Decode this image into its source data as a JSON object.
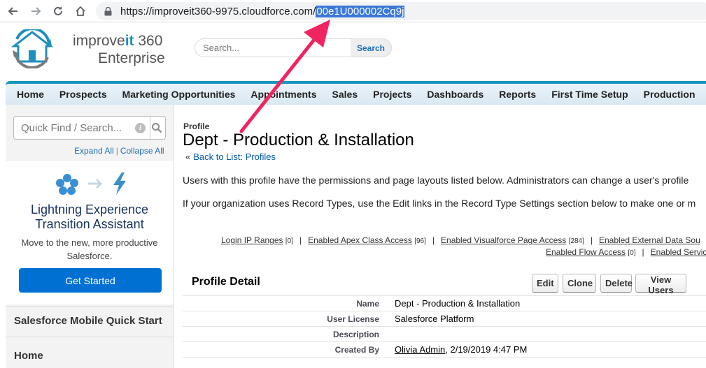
{
  "browser": {
    "url_base": "https://improveit360-9975.cloudforce.com/",
    "url_highlight": "00e1U000002Cq9j"
  },
  "header": {
    "logo_line1_a": "improve",
    "logo_line1_b": "it",
    "logo_line1_c": " 360",
    "logo_line2": "Enterprise",
    "search_placeholder": "Search...",
    "search_button": "Search"
  },
  "tabs": [
    {
      "label": "Home"
    },
    {
      "label": "Prospects"
    },
    {
      "label": "Marketing Opportunities"
    },
    {
      "label": "Appointments"
    },
    {
      "label": "Sales"
    },
    {
      "label": "Projects"
    },
    {
      "label": "Dashboards"
    },
    {
      "label": "Reports"
    },
    {
      "label": "First Time Setup"
    },
    {
      "label": "Production"
    }
  ],
  "sidebar": {
    "quickfind_placeholder": "Quick Find / Search...",
    "info_glyph": "i",
    "expand_all": "Expand All",
    "separator": "|",
    "collapse_all": "Collapse All",
    "lightning_title_1": "Lightning Experience",
    "lightning_title_2": "Transition Assistant",
    "lightning_sub_1": "Move to the new, more productive",
    "lightning_sub_2": "Salesforce.",
    "get_started": "Get Started",
    "mobile_quick_start": "Salesforce Mobile Quick Start",
    "home": "Home"
  },
  "main": {
    "object_type": "Profile",
    "title": "Dept - Production & Installation",
    "back_raquo": "«",
    "back_link": "Back to List: Profiles",
    "para1": "Users with this profile have the permissions and page layouts listed below. Administrators can change a user's profile",
    "para2": "If your organization uses Record Types, use the Edit links in the Record Type Settings section below to make one or m",
    "pipe": "|",
    "related_links_row1": [
      {
        "label": "Login IP Ranges",
        "count": "[0]"
      },
      {
        "label": "Enabled Apex Class Access",
        "count": "[96]"
      },
      {
        "label": "Enabled Visualforce Page Access",
        "count": "[284]"
      },
      {
        "label": "Enabled External Data Sou",
        "count": ""
      }
    ],
    "related_links_row2": [
      {
        "label": "Enabled Flow Access",
        "count": "[0]"
      },
      {
        "label": "Enabled Servic",
        "count": ""
      }
    ],
    "profile_detail_title": "Profile Detail",
    "buttons": {
      "edit": "Edit",
      "clone": "Clone",
      "delete": "Delete",
      "view_users": "View Users"
    },
    "details": [
      {
        "label": "Name",
        "value": "Dept - Production & Installation"
      },
      {
        "label": "User License",
        "value": "Salesforce Platform"
      },
      {
        "label": "Description",
        "value": ""
      },
      {
        "label": "Created By",
        "value_link": "Olivia Admin",
        "value": ", 2/19/2019 4:47 PM"
      }
    ]
  },
  "colors": {
    "tab_accent": "#1797c0",
    "link": "#015ba7",
    "button_primary": "#0070d2",
    "annotation_arrow": "#f0245f",
    "url_highlight": "#3b78d8"
  }
}
